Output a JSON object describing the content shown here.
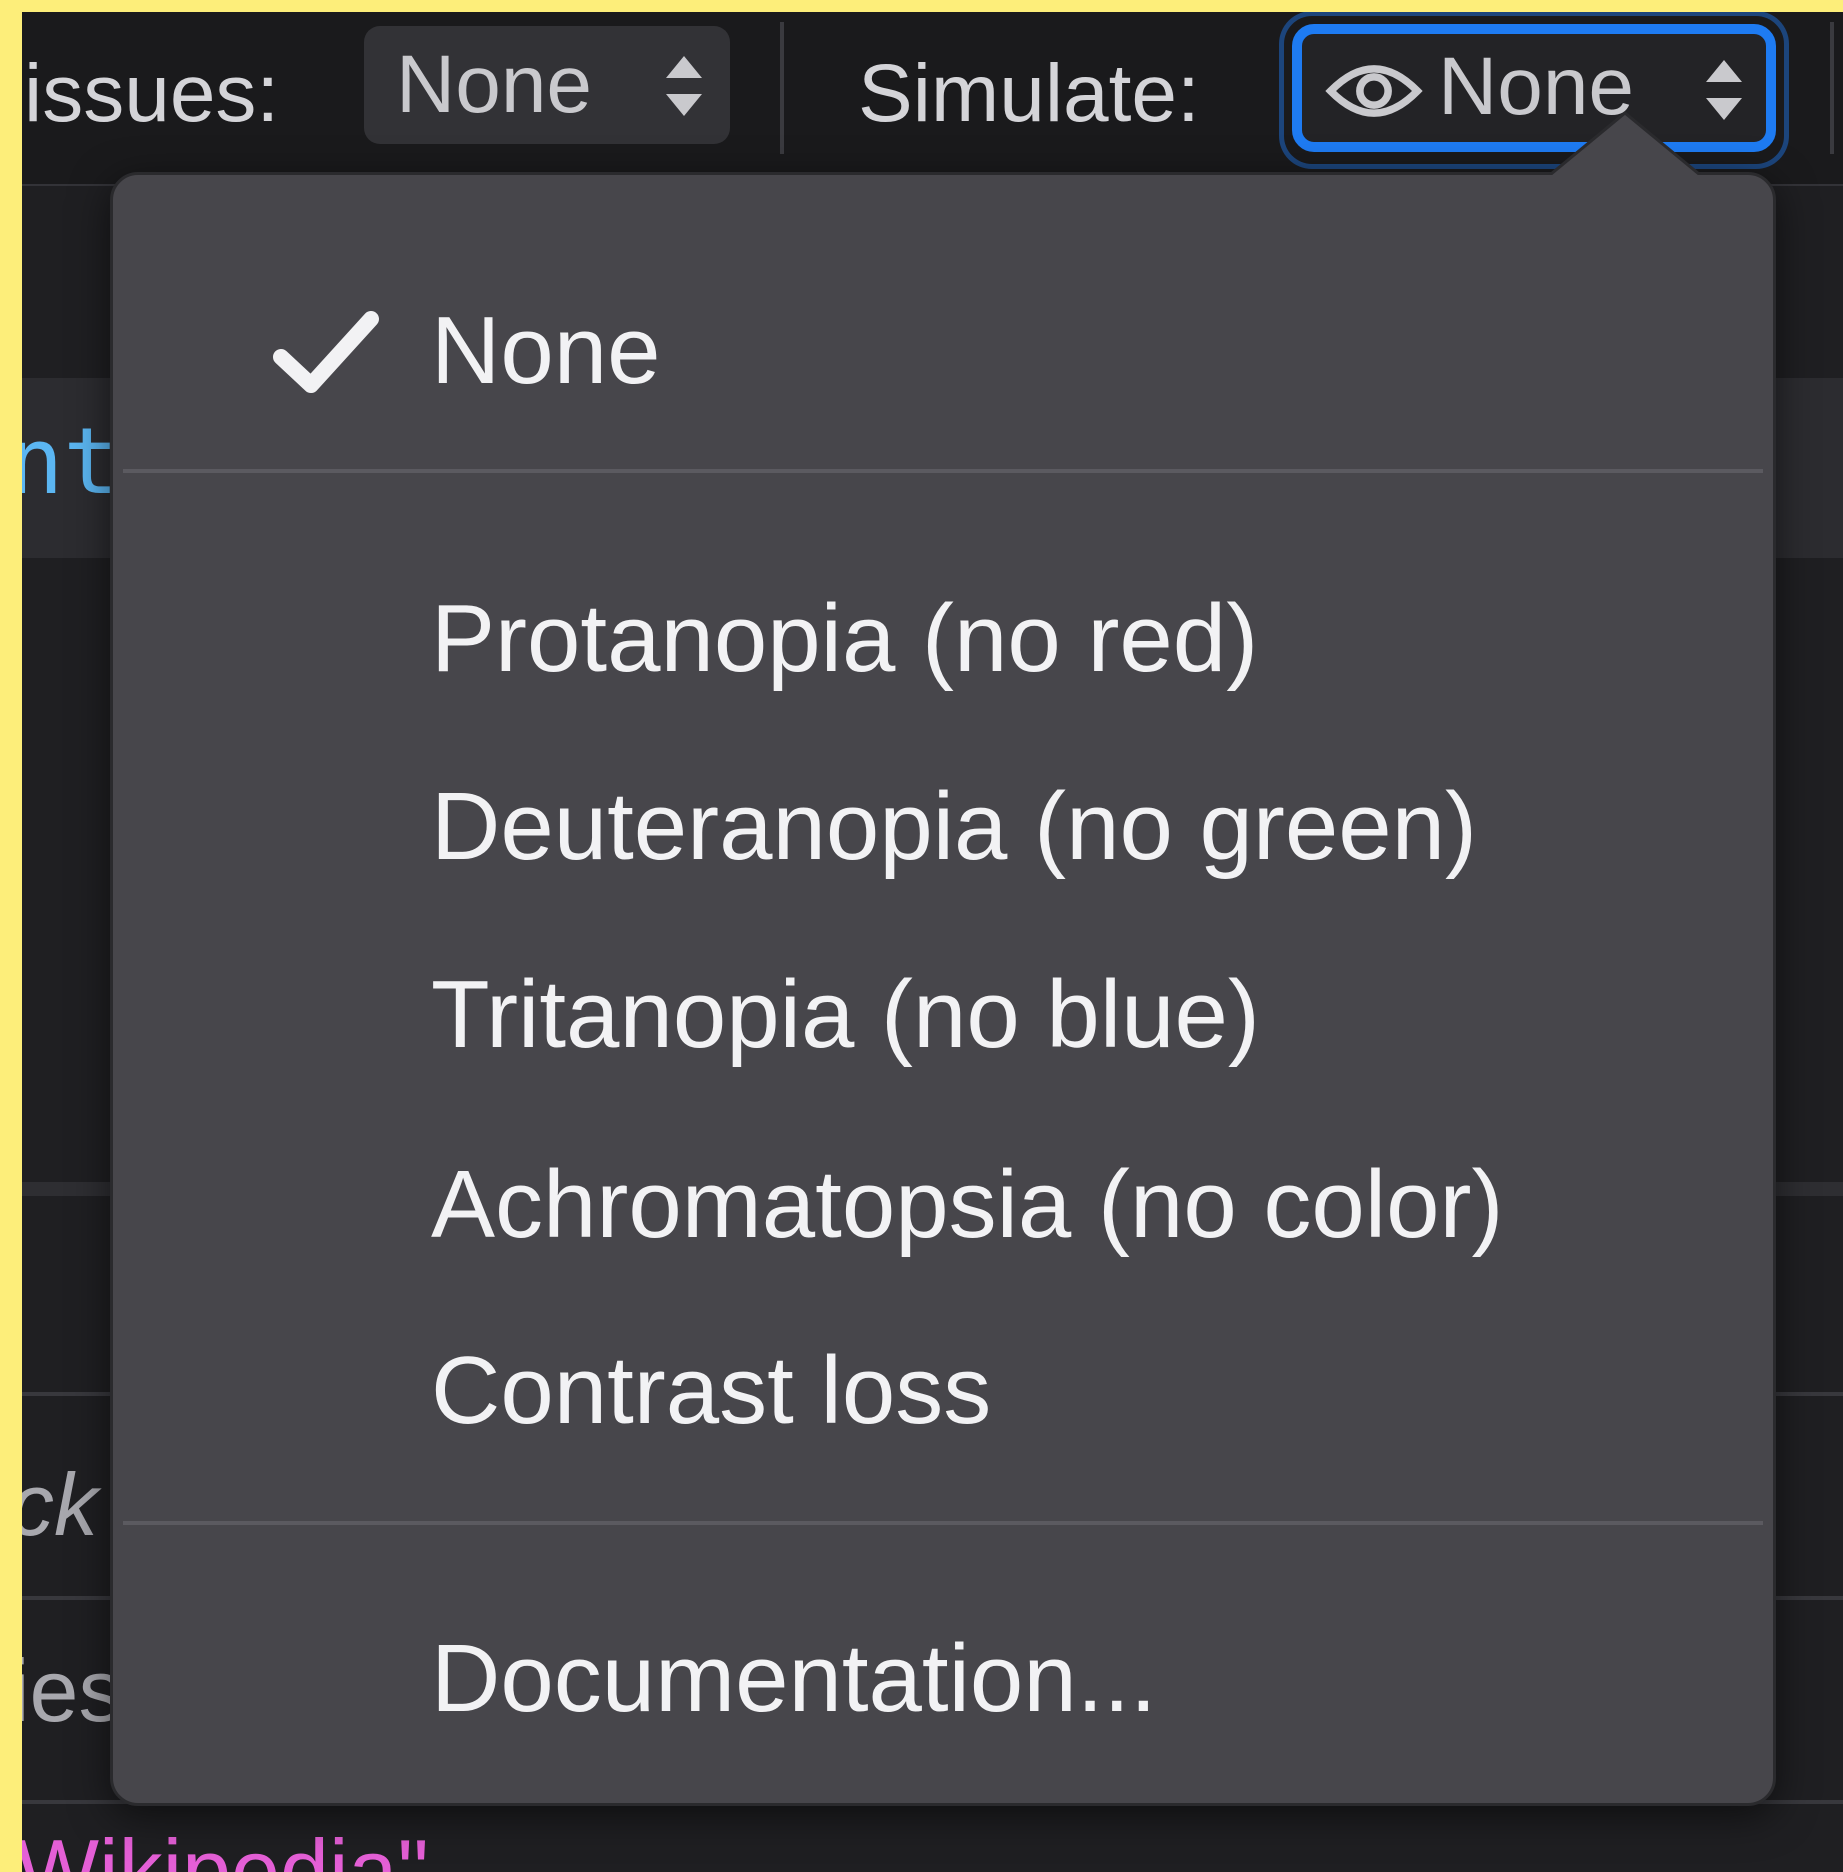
{
  "toolbar": {
    "issues_label": "issues:",
    "issues_value": "None",
    "simulate_label": "Simulate:",
    "simulate_value": "None"
  },
  "background": {
    "fragment_1": "nt",
    "fragment_2": "ck",
    "fragment_3": "ies",
    "fragment_4": "Wikipedia\""
  },
  "menu": {
    "items": [
      {
        "label": "None",
        "checked": true
      },
      {
        "label": "Protanopia (no red)"
      },
      {
        "label": "Deuteranopia (no green)"
      },
      {
        "label": "Tritanopia (no blue)"
      },
      {
        "label": "Achromatopsia (no color)"
      },
      {
        "label": "Contrast loss"
      },
      {
        "label": "Documentation..."
      }
    ]
  },
  "colors": {
    "accent": "#1e7bf2",
    "menu_background": "#47464b",
    "page_border": "#fdee7a"
  }
}
